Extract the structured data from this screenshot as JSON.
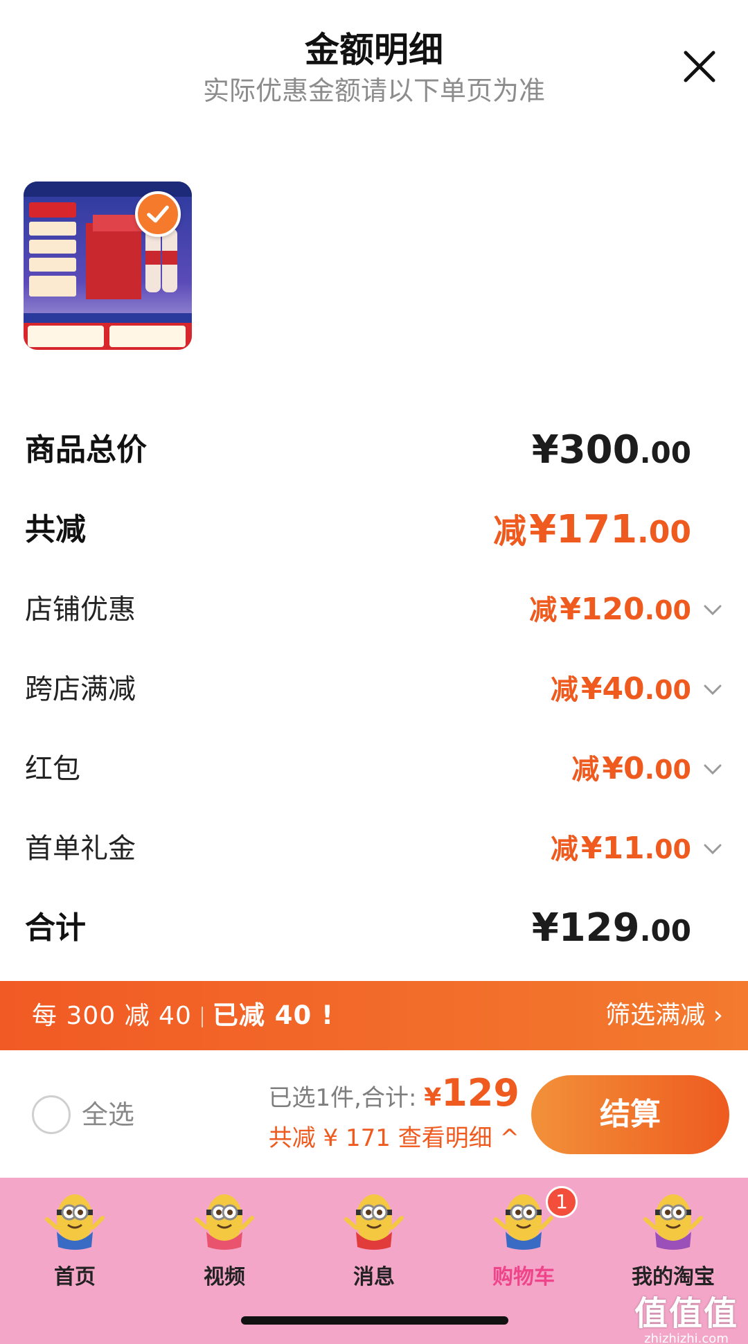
{
  "header": {
    "title": "金额明细",
    "subtitle": "实际优惠金额请以下单页为准",
    "close_icon": "close-icon"
  },
  "product": {
    "image_label": "product-thumbnail",
    "selected": true
  },
  "rows": [
    {
      "label": "商品总价",
      "prefix": "",
      "yen": "¥",
      "int": "300",
      "dec": ".00",
      "style": "dark",
      "expandable": false
    },
    {
      "label": "共减",
      "prefix": "减",
      "yen": "¥",
      "int": "171",
      "dec": ".00",
      "style": "orange-big",
      "expandable": false
    },
    {
      "label": "店铺优惠",
      "prefix": "减",
      "yen": "¥",
      "int": "120",
      "dec": ".00",
      "style": "orange",
      "expandable": true
    },
    {
      "label": "跨店满减",
      "prefix": "减",
      "yen": "¥",
      "int": "40",
      "dec": ".00",
      "style": "orange",
      "expandable": true
    },
    {
      "label": "红包",
      "prefix": "减",
      "yen": "¥",
      "int": "0",
      "dec": ".00",
      "style": "orange",
      "expandable": true
    },
    {
      "label": "首单礼金",
      "prefix": "减",
      "yen": "¥",
      "int": "11",
      "dec": ".00",
      "style": "orange",
      "expandable": true
    },
    {
      "label": "合计",
      "prefix": "",
      "yen": "¥",
      "int": "129",
      "dec": ".00",
      "style": "dark",
      "expandable": false
    }
  ],
  "promo": {
    "rule": "每 300 减 40",
    "status": "已减 40 !",
    "action": "筛选满减 ›"
  },
  "bottom": {
    "select_all": "全选",
    "selected_text": "已选1件,合计: ",
    "total_yen": "¥",
    "total_value": "129",
    "discount_text": "共减 ¥ 171  查看明细 ^",
    "checkout": "结算"
  },
  "tabs": [
    {
      "label": "首页",
      "active": false
    },
    {
      "label": "视频",
      "active": false
    },
    {
      "label": "消息",
      "active": false
    },
    {
      "label": "购物车",
      "active": true,
      "badge": "1"
    },
    {
      "label": "我的淘宝",
      "active": false
    }
  ],
  "watermark": {
    "title": "值值值",
    "site": "zhizhizhi.com"
  },
  "colors": {
    "accent": "#ef5a1f",
    "promo_bg": "#f15a24",
    "tabbar_bg": "#f4a6c9",
    "active_tab": "#f0448a"
  }
}
